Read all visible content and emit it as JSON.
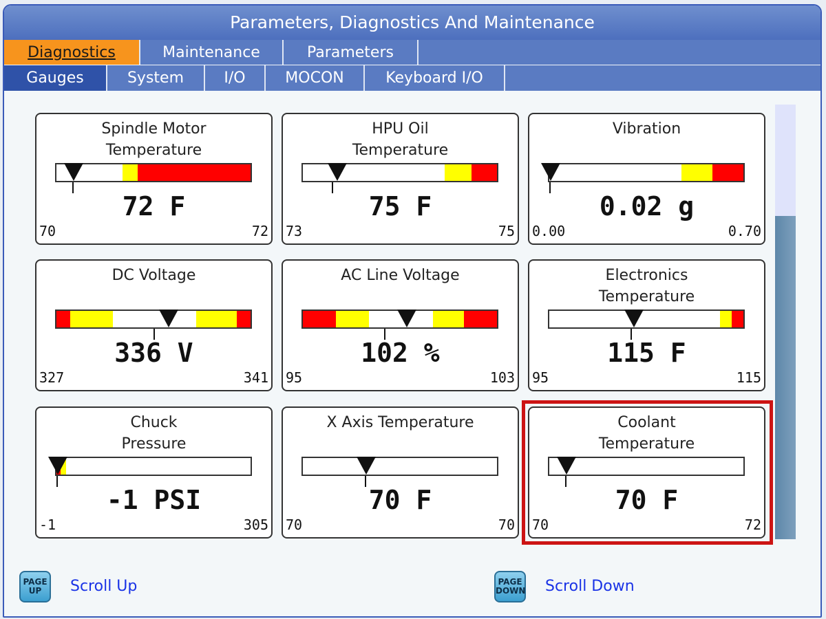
{
  "window": {
    "title": "Parameters, Diagnostics And Maintenance"
  },
  "tabs_main": [
    {
      "label": "Diagnostics",
      "active": true
    },
    {
      "label": "Maintenance",
      "active": false
    },
    {
      "label": "Parameters",
      "active": false
    }
  ],
  "tabs_sub": [
    {
      "label": "Gauges",
      "selected": true
    },
    {
      "label": "System",
      "selected": false
    },
    {
      "label": "I/O",
      "selected": false
    },
    {
      "label": "MOCON",
      "selected": false
    },
    {
      "label": "Keyboard I/O",
      "selected": false
    }
  ],
  "gauges": [
    {
      "title": "Spindle Motor\nTemperature",
      "value": "72 F",
      "min": "70",
      "max": "72",
      "level": 0.08
    },
    {
      "title": "HPU Oil\nTemperature",
      "value": "75 F",
      "min": "73",
      "max": "75",
      "level": 0.17
    },
    {
      "title": "Vibration",
      "value": "0.02 g",
      "min": "0.00",
      "max": "0.70",
      "level": 0.0
    },
    {
      "title": "DC Voltage",
      "value": "336 V",
      "min": "327",
      "max": "341",
      "level": 0.57
    },
    {
      "title": "AC Line Voltage",
      "value": "102 %",
      "min": "95",
      "max": "103",
      "level": 0.53
    },
    {
      "title": "Electronics\nTemperature",
      "value": "115 F",
      "min": "95",
      "max": "115",
      "level": 0.43
    },
    {
      "title": "Chuck\nPressure",
      "value": "-1 PSI",
      "min": "-1",
      "max": "305",
      "level": 0.0
    },
    {
      "title": "X Axis Temperature",
      "value": "70 F",
      "min": "70",
      "max": "70",
      "level": 0.32
    },
    {
      "title": "Coolant\nTemperature",
      "value": "70 F",
      "min": "70",
      "max": "72",
      "level": 0.08
    }
  ],
  "colors": {
    "warning": "#ffff00",
    "danger": "#ff0000",
    "highlight": "#cc1414",
    "tab_active": "#f7941d"
  },
  "footer": {
    "page_up_key": "PAGE\nUP",
    "scroll_up": "Scroll Up",
    "page_down_key": "PAGE\nDOWN",
    "scroll_down": "Scroll Down"
  }
}
